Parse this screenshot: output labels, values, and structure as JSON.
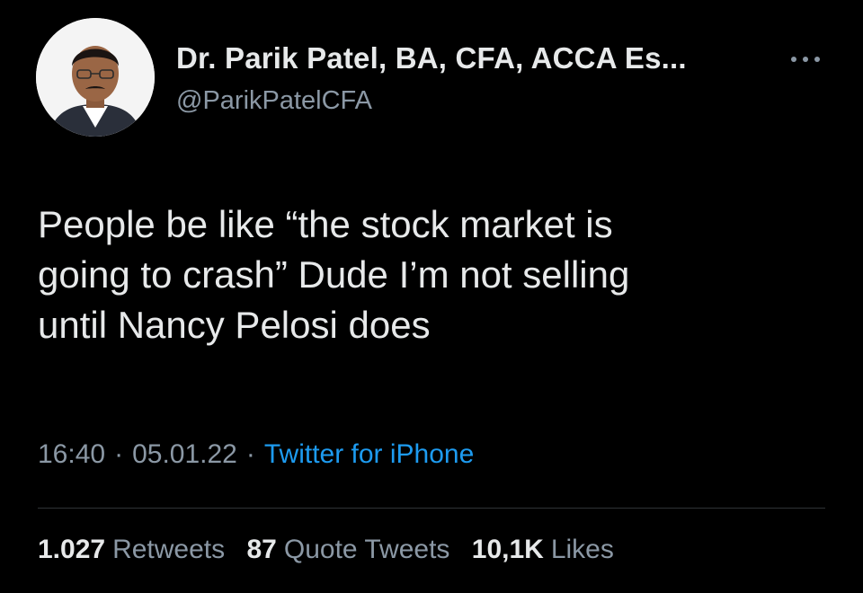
{
  "author": {
    "display_name": "Dr. Parik Patel, BA, CFA, ACCA Es...",
    "handle": "@ParikPatelCFA",
    "avatar_icon": "profile-photo"
  },
  "tweet": {
    "lines": [
      "People be like “the stock market is",
      "going to crash” Dude I’m not selling",
      "until Nancy Pelosi does"
    ]
  },
  "meta": {
    "time": "16:40",
    "separator": "·",
    "date": "05.01.22",
    "source": "Twitter for iPhone"
  },
  "stats": {
    "retweets_count": "1.027",
    "retweets_label": "Retweets",
    "quotes_count": "87",
    "quotes_label": "Quote Tweets",
    "likes_count": "10,1K",
    "likes_label": "Likes"
  },
  "colors": {
    "background": "#000000",
    "text_primary": "#e7e9ea",
    "text_secondary": "#8b98a5",
    "link": "#1d9bf0"
  }
}
